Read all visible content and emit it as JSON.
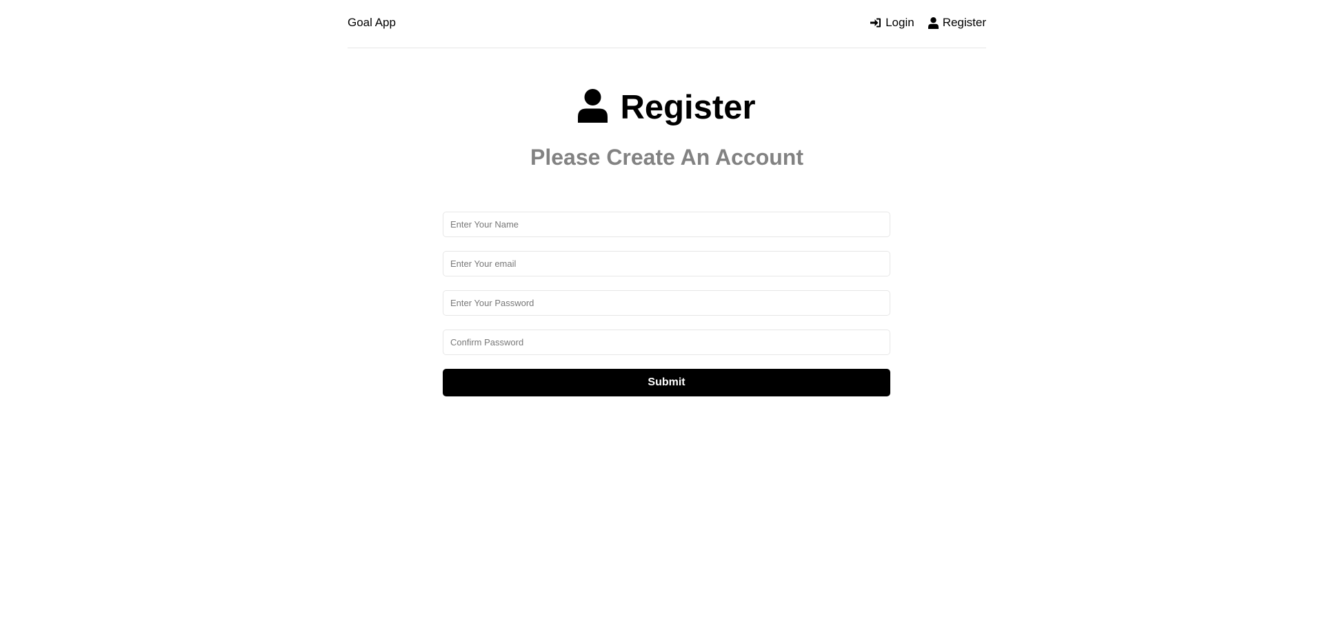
{
  "header": {
    "brand": "Goal App",
    "nav": [
      {
        "label": "Login",
        "icon": "sign-in-icon"
      },
      {
        "label": "Register",
        "icon": "user-icon"
      }
    ]
  },
  "heading": {
    "title": "Register",
    "icon": "user-icon",
    "subtitle": "Please Create An Account"
  },
  "form": {
    "name_placeholder": "Enter Your Name",
    "email_placeholder": "Enter Your email",
    "password_placeholder": "Enter Your Password",
    "confirm_placeholder": "Confirm Password",
    "submit_label": "Submit"
  },
  "colors": {
    "subtitle": "#828282",
    "button_bg": "#000000",
    "button_text": "#ffffff",
    "border": "#e6e6e6"
  }
}
